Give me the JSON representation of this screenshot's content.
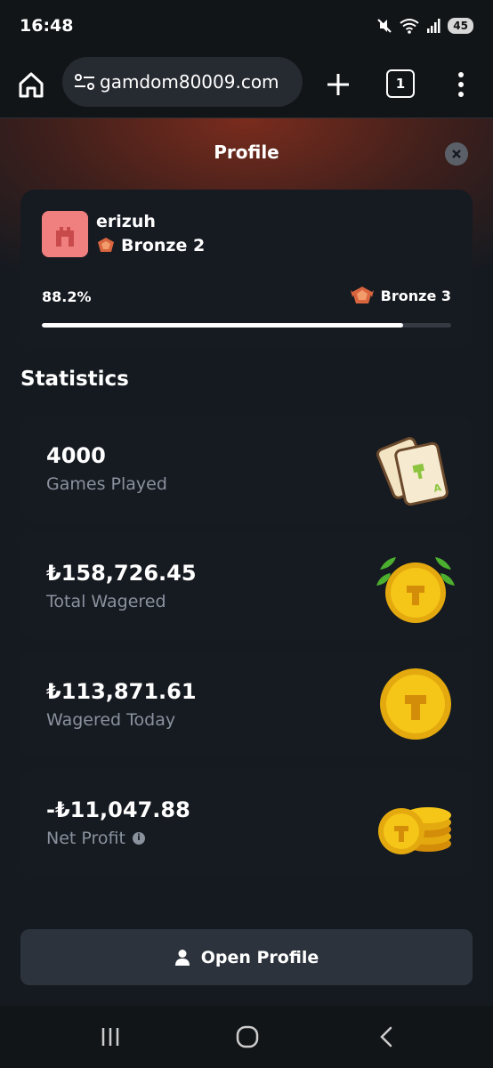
{
  "status_bar": {
    "time": "16:48",
    "battery": "45"
  },
  "browser": {
    "url": "gamdom80009.com",
    "tab_count": "1"
  },
  "profile_header": {
    "title": "Profile"
  },
  "user": {
    "username": "erizuh",
    "rank": "Bronze 2",
    "progress_text": "88.2%",
    "progress": 0.882,
    "next_rank": "Bronze 3",
    "avatar_color": "#f07f7f"
  },
  "statistics": {
    "title": "Statistics",
    "items": [
      {
        "value": "4000",
        "label": "Games Played",
        "icon": "playing-cards-icon"
      },
      {
        "value": "₺158,726.45",
        "label": "Total Wagered",
        "icon": "coin-laurel-icon"
      },
      {
        "value": "₺113,871.61",
        "label": "Wagered Today",
        "icon": "coin-icon"
      },
      {
        "value": "-₺11,047.88",
        "label": "Net Profit",
        "icon": "coin-stack-icon"
      }
    ]
  },
  "actions": {
    "open_profile": "Open Profile"
  },
  "colors": {
    "accent_gradient": "#7a2c1d",
    "card_bg": "#161a21",
    "page_bg": "#151a20"
  }
}
